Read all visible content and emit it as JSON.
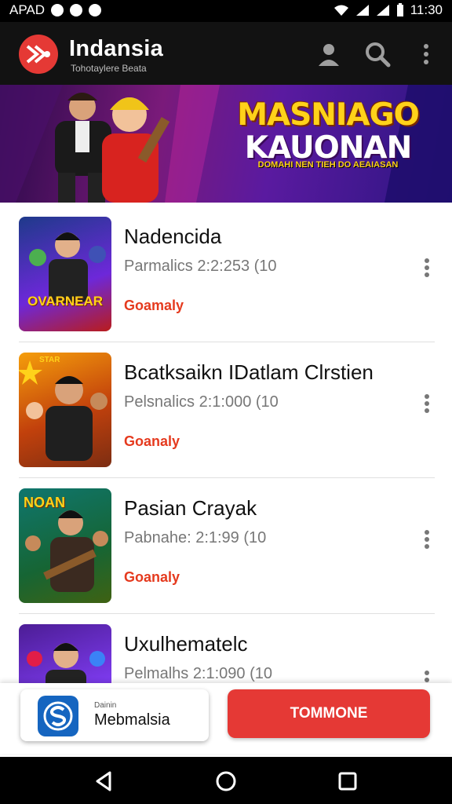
{
  "status_bar": {
    "carrier": "APAD",
    "time": "11:30"
  },
  "app_bar": {
    "title": "Indansia",
    "subtitle": "Tohotaylere Beata",
    "icons": [
      "profile-icon",
      "search-icon",
      "more-vert-icon"
    ]
  },
  "banner": {
    "title_line1": "MASNIAGO",
    "title_line2": "KAUONAN",
    "subtitle": "DOMAHI NEN TIEH DO AEAIASAN"
  },
  "list": {
    "items": [
      {
        "title": "Nadencida",
        "meta": "Parmalics 2:2:253  (10",
        "tag": "Goamaly",
        "thumb_text": "OVARNEAR"
      },
      {
        "title": "Bcatksaikn IDatlam Clrstien",
        "meta": "Pelsnalics 2:1:000  (10",
        "tag": "Goanaly",
        "thumb_text": "STAR"
      },
      {
        "title": "Pasian Crayak",
        "meta": "Pabnahe: 2:1:99  (10",
        "tag": "Goanaly",
        "thumb_text": "NOAN"
      },
      {
        "title": "Uxulhematelc",
        "meta": "Pelmalhs 2:1:090  (10",
        "tag": "",
        "thumb_text": ""
      }
    ]
  },
  "bottom_bar": {
    "card_small": "Dainin",
    "card_name": "Mebmalsia",
    "button_label": "TOMMONE"
  },
  "nav_bar": {
    "buttons": [
      "back-icon",
      "home-icon",
      "recents-icon"
    ]
  },
  "colors": {
    "accent": "#e53935",
    "tag": "#e53a1e",
    "appbar": "#121212"
  }
}
